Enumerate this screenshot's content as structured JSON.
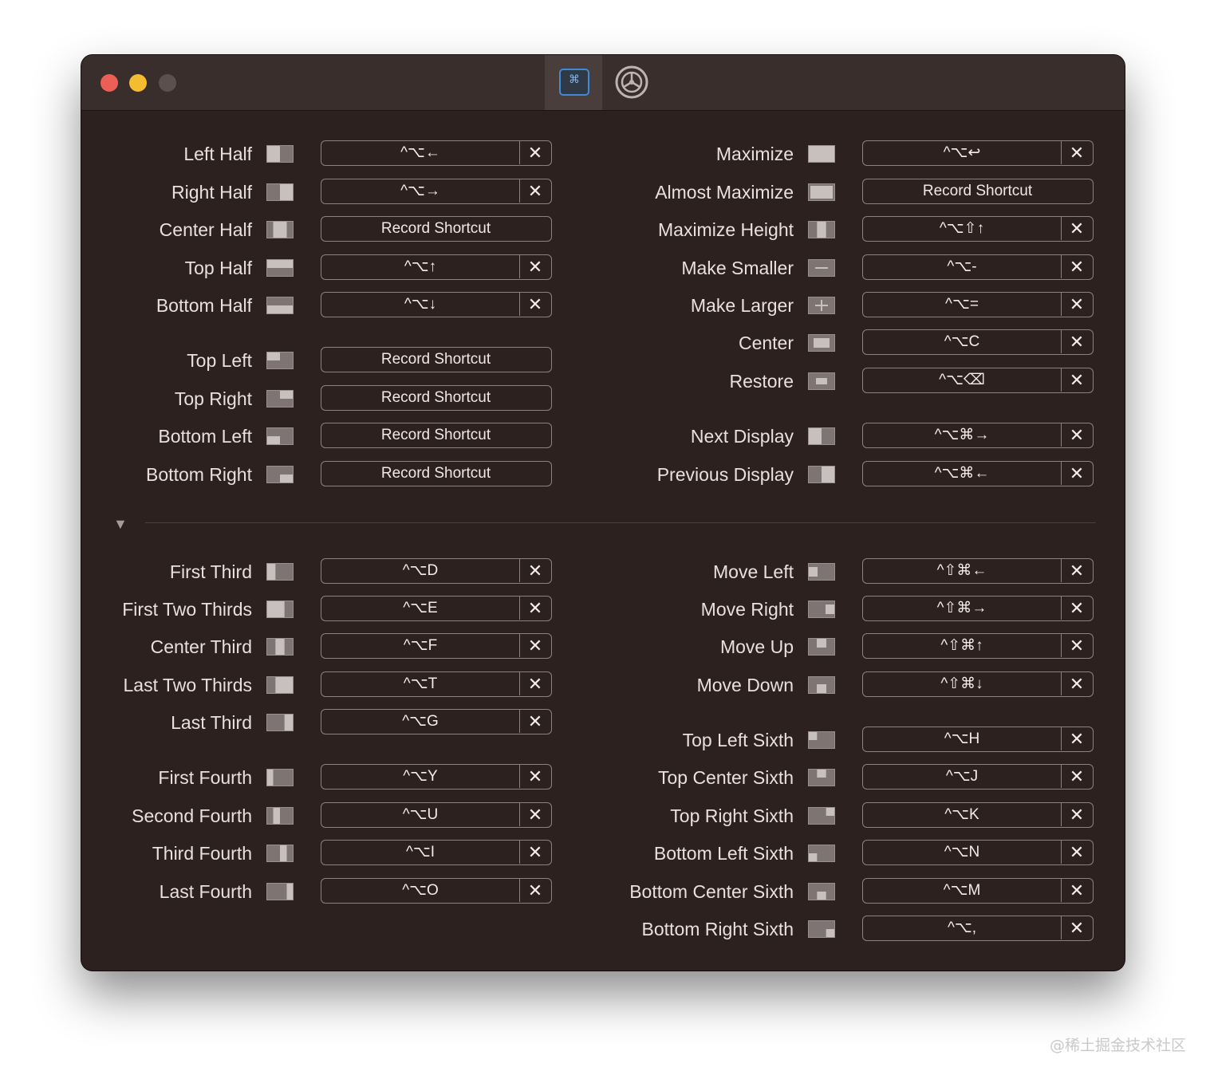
{
  "window": {
    "tabs": [
      {
        "name": "shortcuts",
        "glyph": "⌘"
      },
      {
        "name": "settings",
        "glyph": "gear"
      }
    ]
  },
  "left_top": [
    {
      "label": "Left Half",
      "shortcut": "^⌥←",
      "icon": "left-half-icon"
    },
    {
      "label": "Right Half",
      "shortcut": "^⌥→",
      "icon": "right-half-icon"
    },
    {
      "label": "Center Half",
      "shortcut": "Record Shortcut",
      "icon": "center-half-icon"
    },
    {
      "label": "Top Half",
      "shortcut": "^⌥↑",
      "icon": "top-half-icon"
    },
    {
      "label": "Bottom Half",
      "shortcut": "^⌥↓",
      "icon": "bottom-half-icon"
    },
    {
      "label": "Top Left",
      "shortcut": "Record Shortcut",
      "icon": "top-left-icon"
    },
    {
      "label": "Top Right",
      "shortcut": "Record Shortcut",
      "icon": "top-right-icon"
    },
    {
      "label": "Bottom Left",
      "shortcut": "Record Shortcut",
      "icon": "bottom-left-icon"
    },
    {
      "label": "Bottom Right",
      "shortcut": "Record Shortcut",
      "icon": "bottom-right-icon"
    }
  ],
  "right_top": [
    {
      "label": "Maximize",
      "shortcut": "^⌥↩",
      "icon": "maximize-icon"
    },
    {
      "label": "Almost Maximize",
      "shortcut": "Record Shortcut",
      "icon": "almost-maximize-icon"
    },
    {
      "label": "Maximize Height",
      "shortcut": "^⌥⇧↑",
      "icon": "maximize-height-icon"
    },
    {
      "label": "Make Smaller",
      "shortcut": "^⌥-",
      "icon": "make-smaller-icon"
    },
    {
      "label": "Make Larger",
      "shortcut": "^⌥=",
      "icon": "make-larger-icon"
    },
    {
      "label": "Center",
      "shortcut": "^⌥C",
      "icon": "center-icon"
    },
    {
      "label": "Restore",
      "shortcut": "^⌥⌫",
      "icon": "restore-icon"
    },
    {
      "label": "Next Display",
      "shortcut": "^⌥⌘→",
      "icon": "next-display-icon"
    },
    {
      "label": "Previous Display",
      "shortcut": "^⌥⌘←",
      "icon": "previous-display-icon"
    }
  ],
  "left_bottom": [
    {
      "label": "First Third",
      "shortcut": "^⌥D",
      "icon": "first-third-icon"
    },
    {
      "label": "First Two Thirds",
      "shortcut": "^⌥E",
      "icon": "first-two-thirds-icon"
    },
    {
      "label": "Center Third",
      "shortcut": "^⌥F",
      "icon": "center-third-icon"
    },
    {
      "label": "Last Two Thirds",
      "shortcut": "^⌥T",
      "icon": "last-two-thirds-icon"
    },
    {
      "label": "Last Third",
      "shortcut": "^⌥G",
      "icon": "last-third-icon"
    },
    {
      "label": "First Fourth",
      "shortcut": "^⌥Y",
      "icon": "first-fourth-icon"
    },
    {
      "label": "Second Fourth",
      "shortcut": "^⌥U",
      "icon": "second-fourth-icon"
    },
    {
      "label": "Third Fourth",
      "shortcut": "^⌥I",
      "icon": "third-fourth-icon"
    },
    {
      "label": "Last Fourth",
      "shortcut": "^⌥O",
      "icon": "last-fourth-icon"
    }
  ],
  "right_bottom": [
    {
      "label": "Move Left",
      "shortcut": "^⇧⌘←",
      "icon": "move-left-icon"
    },
    {
      "label": "Move Right",
      "shortcut": "^⇧⌘→",
      "icon": "move-right-icon"
    },
    {
      "label": "Move Up",
      "shortcut": "^⇧⌘↑",
      "icon": "move-up-icon"
    },
    {
      "label": "Move Down",
      "shortcut": "^⇧⌘↓",
      "icon": "move-down-icon"
    },
    {
      "label": "Top Left Sixth",
      "shortcut": "^⌥H",
      "icon": "top-left-sixth-icon"
    },
    {
      "label": "Top Center Sixth",
      "shortcut": "^⌥J",
      "icon": "top-center-sixth-icon"
    },
    {
      "label": "Top Right Sixth",
      "shortcut": "^⌥K",
      "icon": "top-right-sixth-icon"
    },
    {
      "label": "Bottom Left Sixth",
      "shortcut": "^⌥N",
      "icon": "bottom-left-sixth-icon"
    },
    {
      "label": "Bottom Center Sixth",
      "shortcut": "^⌥M",
      "icon": "bottom-center-sixth-icon"
    },
    {
      "label": "Bottom Right Sixth",
      "shortcut": "^⌥,",
      "icon": "bottom-right-sixth-icon"
    }
  ],
  "clear_glyph": "✕",
  "disclosure_glyph": "▼",
  "watermark": "@稀土掘金技术社区",
  "colors": {
    "window_bg": "#2d2120",
    "titlebar_bg": "#3a2e2d",
    "accent": "#3f8ad6",
    "close": "#ec5f57",
    "minimize": "#f4bd30"
  }
}
